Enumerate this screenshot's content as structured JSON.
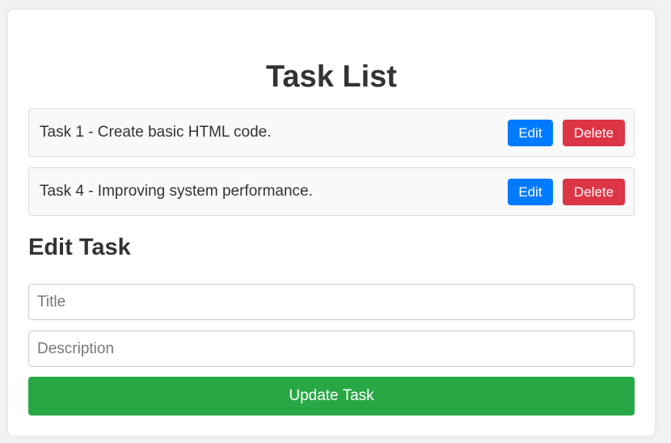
{
  "task_list": {
    "title": "Task List",
    "tasks": [
      {
        "text": "Task 1 - Create basic HTML code.",
        "edit_label": "Edit",
        "delete_label": "Delete"
      },
      {
        "text": "Task 4 - Improving system performance.",
        "edit_label": "Edit",
        "delete_label": "Delete"
      }
    ]
  },
  "edit_form": {
    "title": "Edit Task",
    "title_field": {
      "value": "",
      "placeholder": "Title"
    },
    "description_field": {
      "value": "",
      "placeholder": "Description"
    },
    "submit_label": "Update Task"
  },
  "colors": {
    "edit_button": "#007bff",
    "delete_button": "#dc3545",
    "update_button": "#28a745",
    "task_background": "#f9f9f9"
  }
}
